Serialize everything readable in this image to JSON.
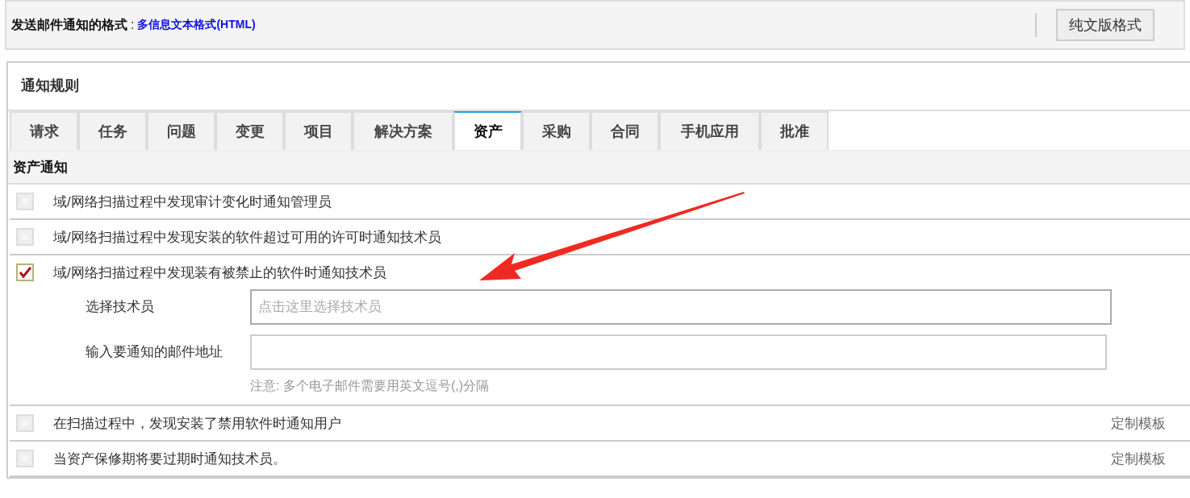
{
  "format_bar": {
    "label": "发送邮件通知的格式",
    "separator": ":",
    "value": "多信息文本格式(HTML)",
    "button": "纯文版格式"
  },
  "panel": {
    "title": "通知规则",
    "tabs": [
      {
        "label": "请求",
        "selected": false
      },
      {
        "label": "任务",
        "selected": false
      },
      {
        "label": "问题",
        "selected": false
      },
      {
        "label": "变更",
        "selected": false
      },
      {
        "label": "项目",
        "selected": false
      },
      {
        "label": "解决方案",
        "selected": false
      },
      {
        "label": "资产",
        "selected": true
      },
      {
        "label": "采购",
        "selected": false
      },
      {
        "label": "合同",
        "selected": false
      },
      {
        "label": "手机应用",
        "selected": false
      },
      {
        "label": "批准",
        "selected": false
      }
    ],
    "section_title": "资产通知",
    "rules": [
      {
        "label": "域/网络扫描过程中发现审计变化时通知管理员",
        "checked": false
      },
      {
        "label": "域/网络扫描过程中发现安装的软件超过可用的许可时通知技术员",
        "checked": false
      },
      {
        "label": "域/网络扫描过程中发现装有被禁止的软件时通知技术员",
        "checked": true,
        "fields": [
          {
            "label": "选择技术员",
            "placeholder": "点击这里选择技术员"
          },
          {
            "label": "输入要通知的邮件地址",
            "note": "注意: 多个电子邮件需要用英文逗号(,)分隔"
          }
        ]
      },
      {
        "label": "在扫描过程中，发现安装了禁用软件时通知用户",
        "checked": false,
        "link": "定制模板"
      },
      {
        "label": "当资产保修期将要过期时通知技术员。",
        "checked": false,
        "link": "定制模板"
      }
    ]
  }
}
